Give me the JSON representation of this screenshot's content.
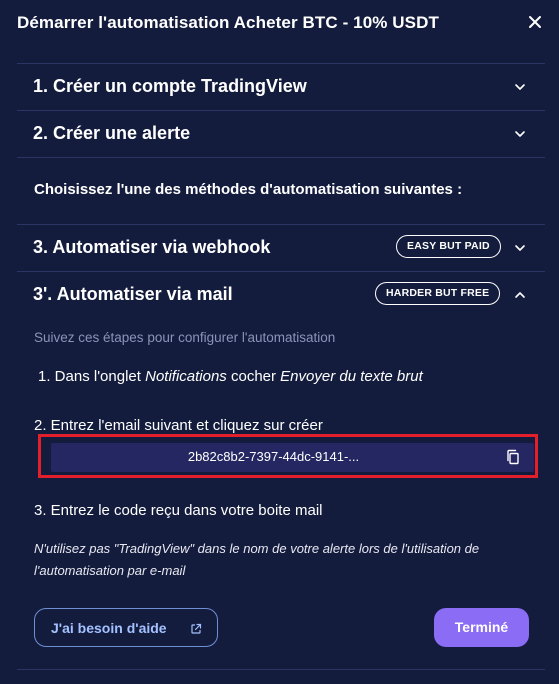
{
  "header": {
    "title": "Démarrer l'automatisation Acheter BTC - 10% USDT",
    "close_icon": "close-icon"
  },
  "accordion": [
    {
      "label": "1. Créer un compte TradingView",
      "expanded": false
    },
    {
      "label": "2. Créer une alerte",
      "expanded": false
    },
    {
      "label": "3. Automatiser via webhook",
      "badge": "EASY BUT PAID",
      "expanded": false
    },
    {
      "label": "3'. Automatiser via mail",
      "badge": "HARDER BUT FREE",
      "expanded": true
    }
  ],
  "methods_prompt": "Choisissez l'une des méthodes d'automatisation suivantes :",
  "mail_section": {
    "subtitle": "Suivez ces étapes pour configurer l'automatisation",
    "step1": {
      "prefix": "1. Dans l'onglet ",
      "emph1": "Notifications",
      "middle": " cocher ",
      "emph2": "Envoyer du texte brut"
    },
    "step2": "2. Entrez l'email suivant et cliquez sur créer",
    "email": "2b82c8b2-7397-44dc-9141-...",
    "copy_icon": "copy-icon",
    "step3": "3. Entrez le code reçu dans votre boite mail",
    "note": "N'utilisez pas \"TradingView\" dans le nom de votre alerte lors de l'utilisation de l'automatisation par e-mail"
  },
  "footer": {
    "help_label": "J'ai besoin d'aide",
    "help_icon": "external-link-icon",
    "done_label": "Terminé"
  },
  "colors": {
    "background": "#141c3d",
    "divider": "#2b3563",
    "highlight": "#e21f2a",
    "email_box": "#242761",
    "primary_button": "#8a6cf5",
    "link_blue": "#a3c1ff"
  }
}
